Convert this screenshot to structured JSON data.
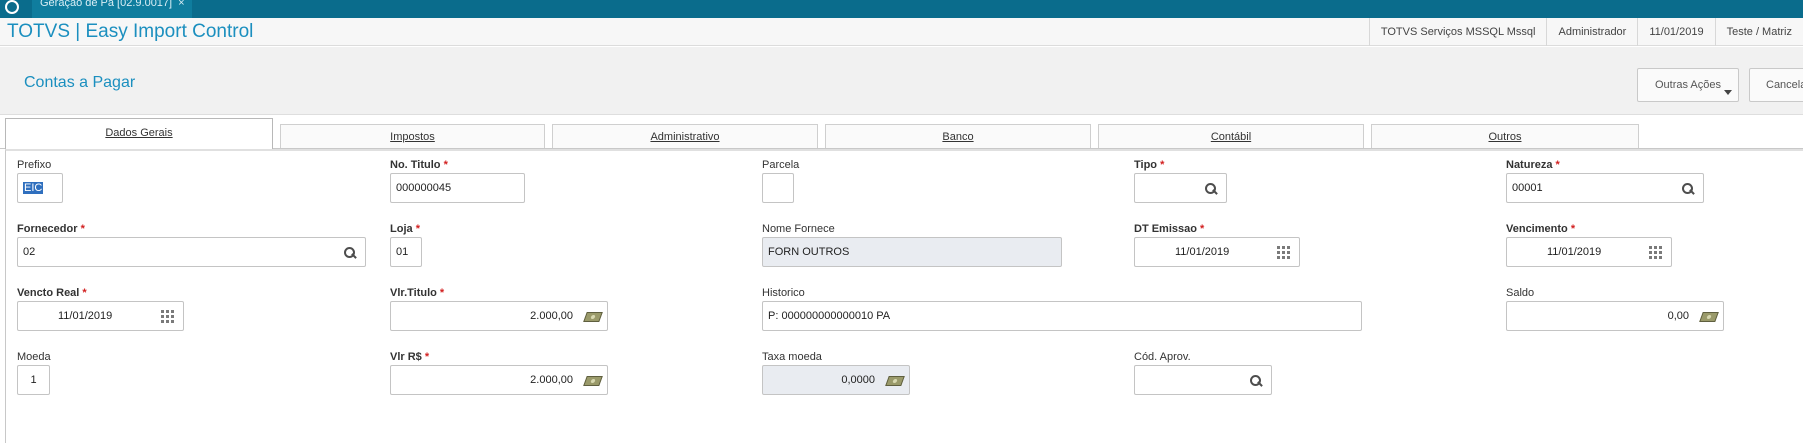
{
  "window": {
    "tab_title": "Geração de Pa [02.9.0017]",
    "tab_close": "×"
  },
  "app": {
    "title": "TOTVS | Easy Import Control",
    "info": [
      "TOTVS Serviços MSSQL Mssql",
      "Administrador",
      "11/01/2019",
      "Teste / Matriz"
    ]
  },
  "page": {
    "title": "Contas a Pagar",
    "actions": {
      "more": "Outras Ações",
      "cancel": "Cancelar"
    }
  },
  "tabs": [
    "Dados Gerais",
    "Impostos",
    "Administrativo",
    "Banco",
    "Contábil",
    "Outros"
  ],
  "form": {
    "required_mark": "*",
    "prefixo": {
      "label": "Prefixo",
      "value": "EIC"
    },
    "no_titulo": {
      "label": "No. Titulo",
      "value": "000000045"
    },
    "parcela": {
      "label": "Parcela",
      "value": ""
    },
    "tipo": {
      "label": "Tipo",
      "value": ""
    },
    "natureza": {
      "label": "Natureza",
      "value": "00001"
    },
    "fornecedor": {
      "label": "Fornecedor",
      "value": "02"
    },
    "loja": {
      "label": "Loja",
      "value": "01"
    },
    "nome_fornece": {
      "label": "Nome Fornece",
      "value": "FORN OUTROS"
    },
    "dt_emissao": {
      "label": "DT Emissao",
      "value": "11/01/2019"
    },
    "vencimento": {
      "label": "Vencimento",
      "value": "11/01/2019"
    },
    "vencto_real": {
      "label": "Vencto Real",
      "value": "11/01/2019"
    },
    "vlr_titulo": {
      "label": "Vlr.Titulo",
      "value": "2.000,00"
    },
    "historico": {
      "label": "Historico",
      "value": "P: 000000000000010 PA"
    },
    "saldo": {
      "label": "Saldo",
      "value": "0,00"
    },
    "moeda": {
      "label": "Moeda",
      "value": "1"
    },
    "vlr_rs": {
      "label": "Vlr R$",
      "value": "2.000,00"
    },
    "taxa_moeda": {
      "label": "Taxa moeda",
      "value": "0,0000"
    },
    "cod_aprov": {
      "label": "Cód. Aprov.",
      "value": ""
    }
  }
}
